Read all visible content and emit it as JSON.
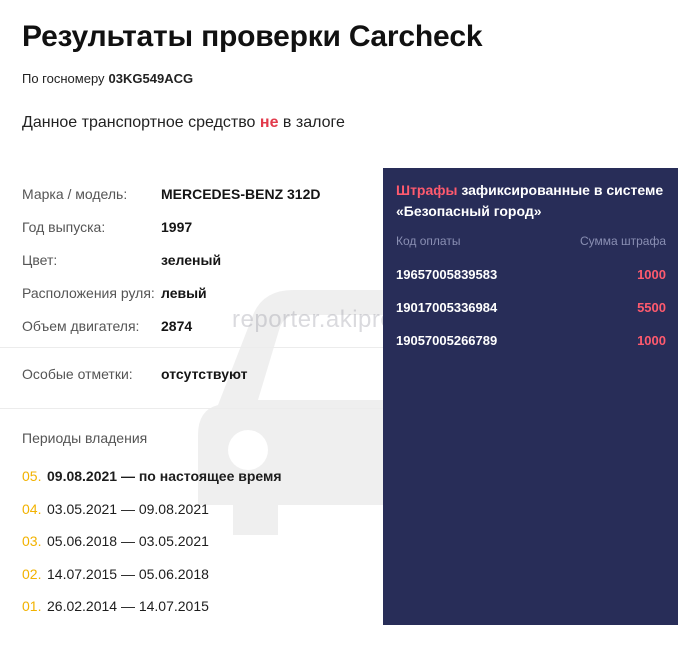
{
  "header": {
    "title": "Результаты проверки Carcheck",
    "plate_label": "По госномеру",
    "plate": "03KG549ACG"
  },
  "pledge": {
    "before": "Данное транспортное средство ",
    "negation": "не",
    "after": " в залоге"
  },
  "specs": [
    {
      "label": "Марка / модель:",
      "value": "MERCEDES-BENZ 312D"
    },
    {
      "label": "Год выпуска:",
      "value": "1997"
    },
    {
      "label": "Цвет:",
      "value": "зеленый"
    },
    {
      "label": "Расположения руля:",
      "value": "левый"
    },
    {
      "label": "Объем двигателя:",
      "value": "2874"
    }
  ],
  "marks": {
    "label": "Особые отметки:",
    "value": "отсутствуют"
  },
  "ownership": {
    "title": "Периоды владения",
    "periods": [
      {
        "num": "05.",
        "range": "09.08.2021 — по настоящее время"
      },
      {
        "num": "04.",
        "range": "03.05.2021 — 09.08.2021"
      },
      {
        "num": "03.",
        "range": "05.06.2018 — 03.05.2021"
      },
      {
        "num": "02.",
        "range": "14.07.2015 — 05.06.2018"
      },
      {
        "num": "01.",
        "range": "26.02.2014 — 14.07.2015"
      }
    ]
  },
  "fines": {
    "title_accent": "Штрафы",
    "title_rest": " зафиксированные в системе «Безопасный город»",
    "col_code": "Код оплаты",
    "col_amount": "Сумма штрафа",
    "items": [
      {
        "code": "19657005839583",
        "amount": "1000"
      },
      {
        "code": "19017005336984",
        "amount": "5500"
      },
      {
        "code": "19057005266789",
        "amount": "1000"
      }
    ]
  },
  "watermark": {
    "text": "reporter.akipress.org",
    "icon": "car-icon"
  },
  "colors": {
    "accent_red": "#e23a4b",
    "fines_bg": "#282d58",
    "period_num": "#f2b200"
  }
}
